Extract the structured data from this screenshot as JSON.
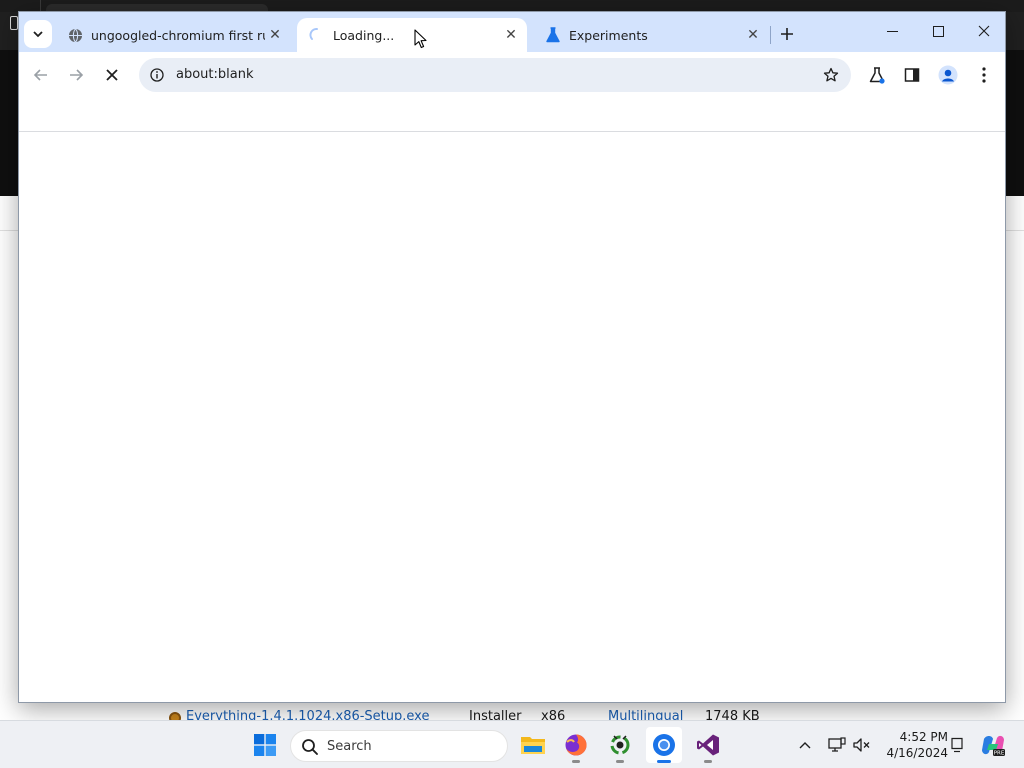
{
  "browser": {
    "tabs": [
      {
        "title": "ungoogled-chromium first run",
        "icon": "globe-icon",
        "active": false
      },
      {
        "title": "Loading...",
        "icon": "loading-spinner-icon",
        "active": true
      },
      {
        "title": "Experiments",
        "icon": "flask-icon",
        "active": false
      }
    ],
    "address": "about:blank",
    "accent_color": "#d3e3fd"
  },
  "background_window": {
    "row": {
      "name": "Everything-1.4.1.1024.x86-Setup.exe",
      "type": "Installer",
      "arch": "x86",
      "lang": "Multilingual",
      "size": "1748 KB"
    }
  },
  "taskbar": {
    "search_placeholder": "Search",
    "apps": [
      "start-icon",
      "file-explorer-icon",
      "firefox-icon",
      "recycle-app-icon",
      "chromium-icon",
      "visual-studio-icon"
    ],
    "time": "4:52 PM",
    "date": "4/16/2024"
  }
}
